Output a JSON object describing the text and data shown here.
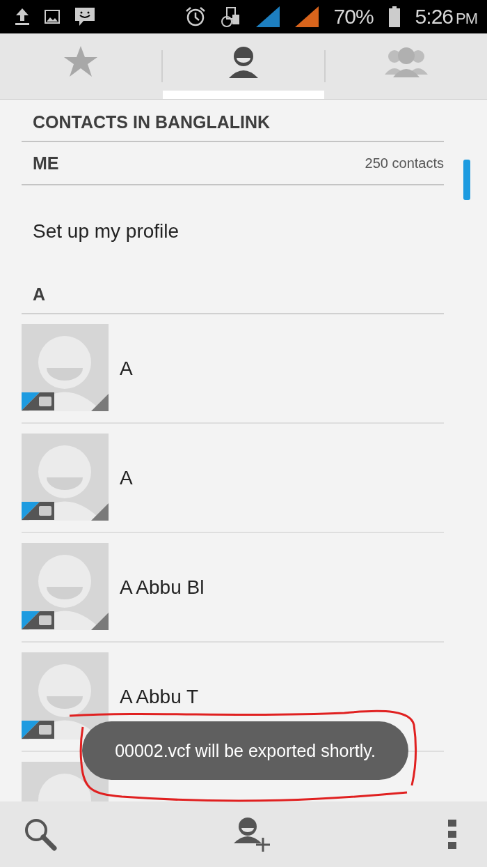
{
  "status_bar": {
    "battery": "70%",
    "time": "5:26",
    "time_suffix": "PM"
  },
  "tabs": [
    {
      "kind": "favorites",
      "selected": false
    },
    {
      "kind": "contacts",
      "selected": true
    },
    {
      "kind": "groups",
      "selected": false
    }
  ],
  "header": "CONTACTS IN BANGLALINK",
  "me": {
    "label": "ME",
    "count": "250 contacts"
  },
  "profile": "Set up my profile",
  "section": "A",
  "contacts": [
    {
      "kind": "named",
      "name": "A"
    },
    {
      "kind": "named",
      "name": "A"
    },
    {
      "kind": "named",
      "name": "A Abbu Bl"
    },
    {
      "kind": "named",
      "name": "A Abbu T"
    },
    {
      "kind": "covered"
    }
  ],
  "toast": "00002.vcf will be exported shortly."
}
